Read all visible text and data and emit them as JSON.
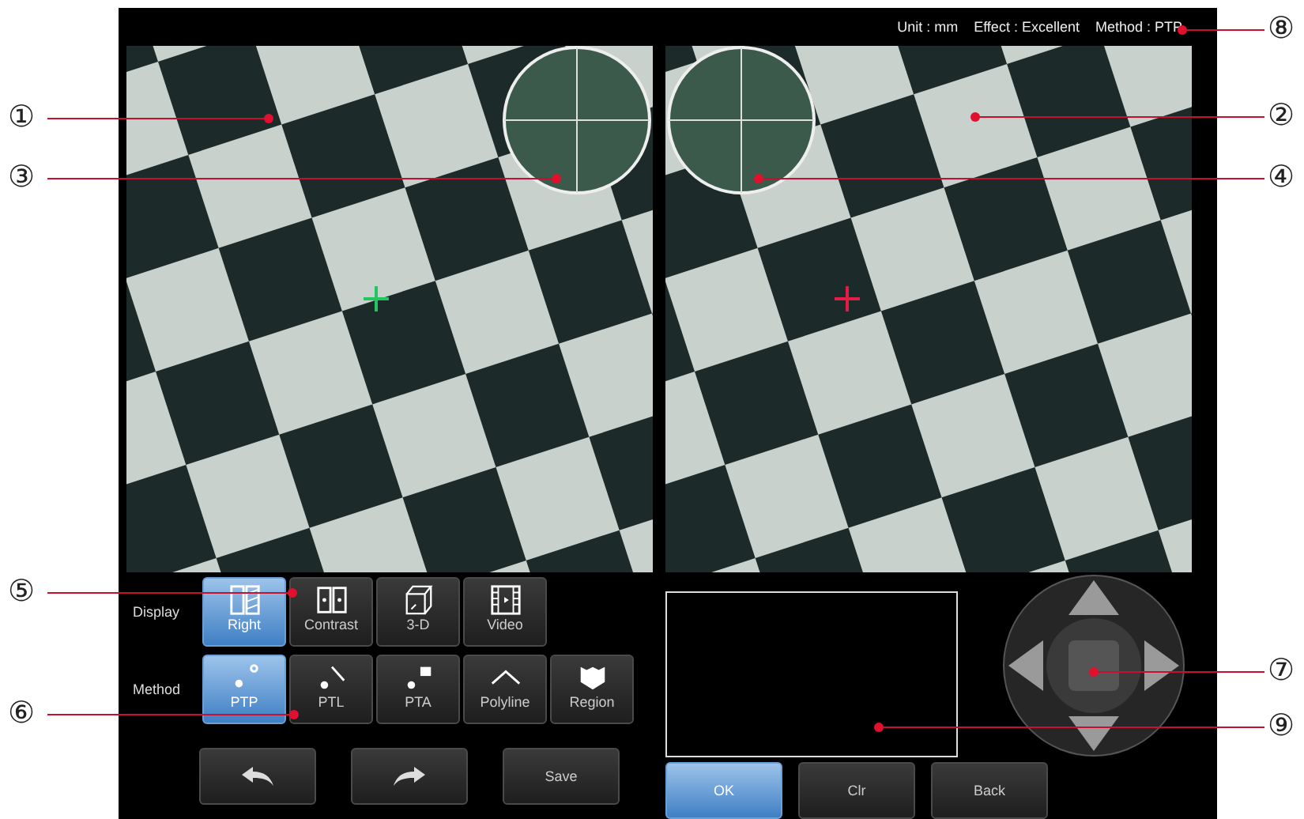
{
  "status": {
    "items": [
      "Unit : mm",
      "Effect : Excellent",
      "Method : PTP"
    ]
  },
  "views": [
    {
      "magnifier_on_right": true,
      "color": "#22c55e"
    },
    {
      "magnifier_on_right": false,
      "color": "#e11d48"
    }
  ],
  "display": {
    "label": "Display",
    "buttons": [
      {
        "label": "Right",
        "kind": "split",
        "selected": true
      },
      {
        "label": "Contrast",
        "kind": "contrast",
        "selected": false
      },
      {
        "label": "3-D",
        "kind": "cube",
        "selected": false
      },
      {
        "label": "Video",
        "kind": "film",
        "selected": false
      }
    ]
  },
  "method": {
    "label": "Method",
    "buttons": [
      {
        "label": "PTP",
        "kind": "ptp",
        "selected": true
      },
      {
        "label": "PTL",
        "kind": "ptl",
        "selected": false
      },
      {
        "label": "PTA",
        "kind": "pta",
        "selected": false
      },
      {
        "label": "Polyline",
        "kind": "polyline",
        "selected": false
      },
      {
        "label": "Region",
        "kind": "region",
        "selected": false
      }
    ]
  },
  "actions": [
    {
      "kind": "undo"
    },
    {
      "kind": "redo"
    },
    {
      "kind": "text",
      "label": "Save"
    }
  ],
  "confirm": [
    {
      "label": "OK",
      "selected": true
    },
    {
      "label": "Clr",
      "selected": false
    },
    {
      "label": "Back",
      "selected": false
    }
  ],
  "callouts": [
    "⑧",
    "①",
    "②",
    "③",
    "④",
    "⑤",
    "⑦",
    "⑥",
    "⑨"
  ]
}
